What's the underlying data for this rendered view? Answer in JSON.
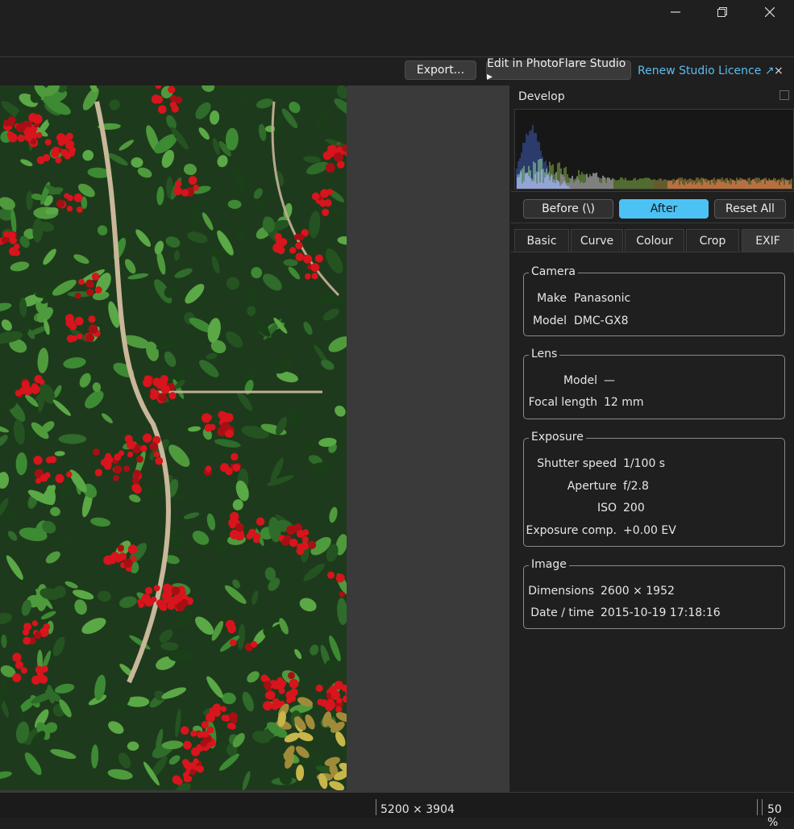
{
  "window": {
    "minimize_icon": "minimize-icon",
    "restore_icon": "restore-icon",
    "close_icon": "close-icon"
  },
  "toolbar": {
    "export_label": "Export...",
    "edit_label": "Edit in PhotoFlare Studio ▸",
    "renew_label": "Renew Studio Licence ↗",
    "dismiss_label": "×"
  },
  "panel": {
    "title": "Develop",
    "buttons": {
      "before": "Before  (\\)",
      "after": "After",
      "reset": "Reset All"
    },
    "tabs": [
      "Basic",
      "Curve",
      "Colour",
      "Crop",
      "EXIF"
    ],
    "active_tab": "EXIF"
  },
  "exif": {
    "camera": {
      "title": "Camera",
      "make_label": "Make",
      "make": "Panasonic",
      "model_label": "Model",
      "model": "DMC-GX8"
    },
    "lens": {
      "title": "Lens",
      "model_label": "Model",
      "model": "—",
      "focal_label": "Focal length",
      "focal": "12 mm"
    },
    "exposure": {
      "title": "Exposure",
      "shutter_label": "Shutter speed",
      "shutter": "1/100 s",
      "aperture_label": "Aperture",
      "aperture": "f/2.8",
      "iso_label": "ISO",
      "iso": "200",
      "comp_label": "Exposure comp.",
      "comp": "+0.00 EV"
    },
    "image": {
      "title": "Image",
      "dimensions_label": "Dimensions",
      "dimensions": "2600 × 1952",
      "datetime_label": "Date / time",
      "datetime": "2015-10-19  17:18:16"
    }
  },
  "status": {
    "image_size": "5200 × 3904",
    "zoom": "50 %"
  },
  "colors": {
    "accent": "#4cc2f4",
    "link": "#5bbdf0",
    "background": "#1f1f1f",
    "canvas": "#3a3a3a"
  }
}
